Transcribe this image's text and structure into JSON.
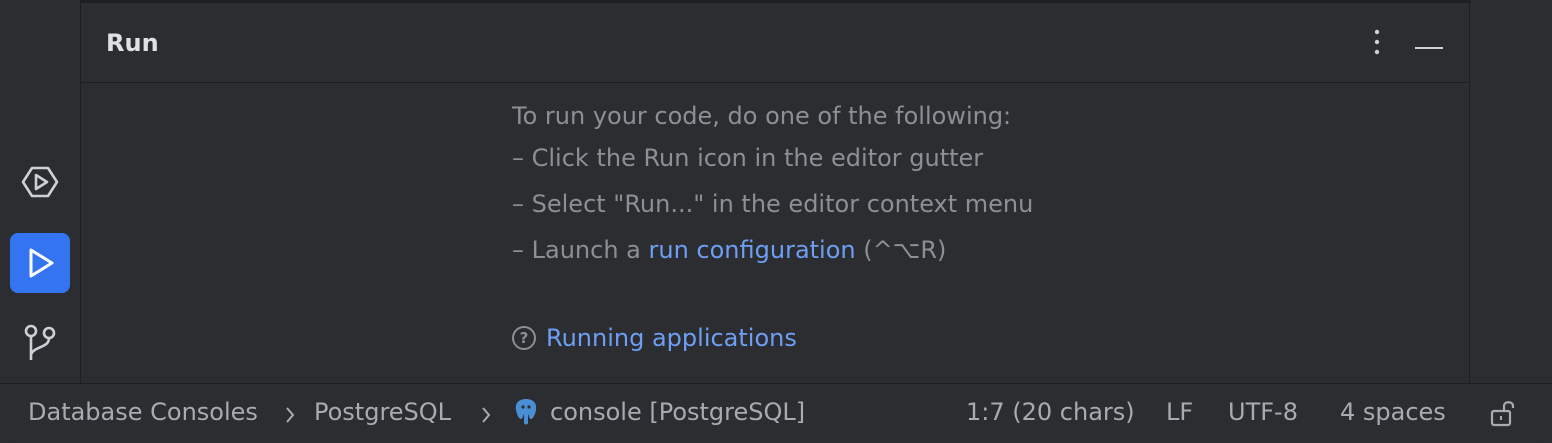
{
  "panel": {
    "title": "Run"
  },
  "empty_state": {
    "intro": "To run your code, do one of the following:",
    "option1": "– Click the Run icon in the editor gutter",
    "option2": "– Select \"Run...\" in the editor context menu",
    "option3_prefix": "– Launch a ",
    "option3_link": "run configuration",
    "option3_shortcut": " (^⌥R)",
    "help_link": "Running applications"
  },
  "status_bar": {
    "breadcrumb": [
      "Database Consoles",
      "PostgreSQL",
      "console [PostgreSQL]"
    ],
    "position": "1:7 (20 chars)",
    "line_separator": "LF",
    "encoding": "UTF-8",
    "indent": "4 spaces"
  },
  "icons": {
    "services": "services-icon",
    "run": "run-icon",
    "vcs": "git-branch-icon",
    "more": "more-vertical-icon",
    "minimize": "minimize-icon",
    "postgres": "postgresql-icon",
    "lock": "unlock-icon",
    "help": "help-icon"
  },
  "colors": {
    "accent": "#3574f0",
    "link": "#6e9ff5",
    "background": "#2b2d30"
  }
}
